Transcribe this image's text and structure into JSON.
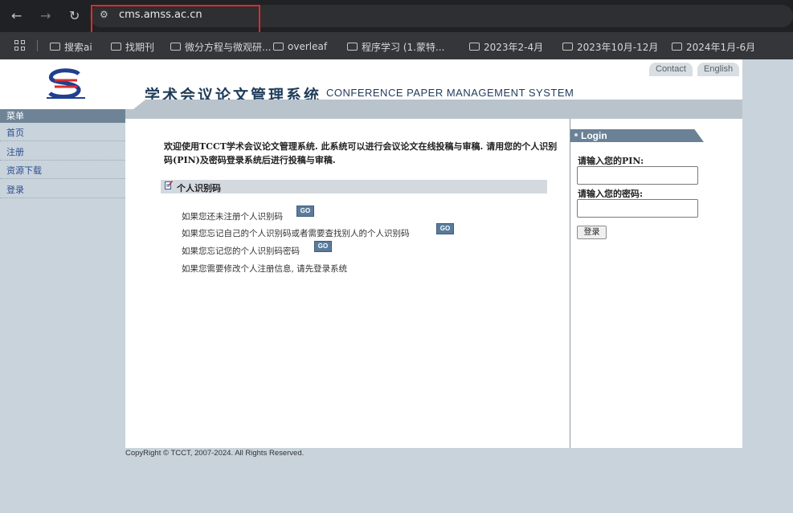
{
  "browser": {
    "url": "cms.amss.ac.cn",
    "bookmarks": [
      "搜索ai",
      "找期刊",
      "微分方程与微观研...",
      "overleaf",
      "程序学习 (1.蒙特...",
      "2023年2-4月",
      "2023年10月-12月",
      "2024年1月-6月"
    ]
  },
  "header": {
    "title_cn": "学术会议论文管理系统",
    "title_en": "CONFERENCE PAPER MANAGEMENT SYSTEM",
    "links": [
      "Contact",
      "English"
    ]
  },
  "sidebar": {
    "heading": "菜单",
    "items": [
      "首页",
      "注册",
      "资源下载",
      "登录"
    ]
  },
  "main": {
    "welcome": "欢迎使用TCCT学术会议论文管理系统. 此系统可以进行会议论文在线投稿与审稿. 请用您的个人识别码(PIN)及密码登录系统后进行投稿与审稿.",
    "section_title": "个人识别码",
    "rows": [
      "如果您还未注册个人识别码",
      "如果您忘记自己的个人识别码或者需要查找别人的个人识别码",
      "如果您忘记您的个人识别码密码",
      "如果您需要修改个人注册信息, 请先登录系统"
    ],
    "go_label": "GO"
  },
  "login": {
    "title": "Login",
    "pin_label": "请输入您的PIN:",
    "password_label": "请输入您的密码:",
    "button": "登录"
  },
  "footer": {
    "copyright": "CopyRight © TCCT, 2007-2024. All Rights Reserved."
  }
}
